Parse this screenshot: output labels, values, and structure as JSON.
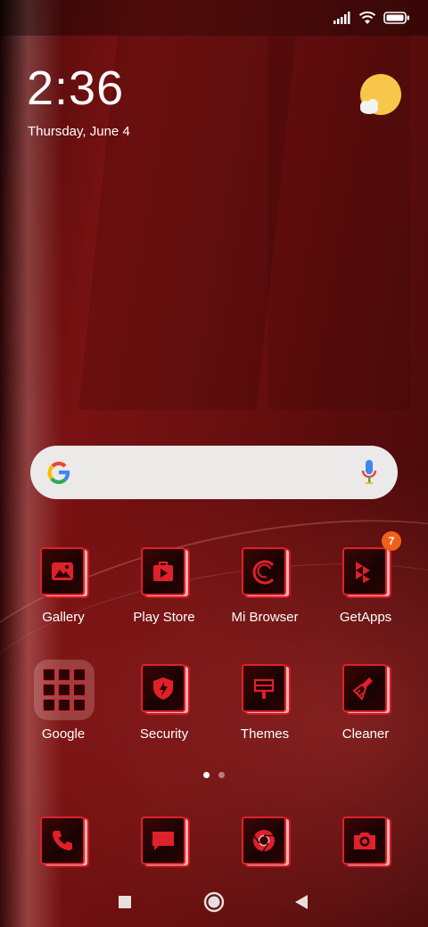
{
  "status": {
    "signal_icon": "signal-bars-icon",
    "wifi_icon": "wifi-icon",
    "battery_icon": "battery-icon"
  },
  "clock": {
    "time": "2:36",
    "date": "Thursday, June 4"
  },
  "weather": {
    "icon": "sunny-partly-cloudy-icon"
  },
  "search": {
    "logo_icon": "google-g-icon",
    "mic_icon": "microphone-icon"
  },
  "apps_row1": [
    {
      "label": "Gallery",
      "icon": "gallery-icon"
    },
    {
      "label": "Play Store",
      "icon": "play-store-icon"
    },
    {
      "label": "Mi Browser",
      "icon": "browser-icon"
    },
    {
      "label": "GetApps",
      "icon": "getapps-icon",
      "badge": "7"
    }
  ],
  "apps_row2": [
    {
      "label": "Google",
      "icon": "folder-icon"
    },
    {
      "label": "Security",
      "icon": "security-icon"
    },
    {
      "label": "Themes",
      "icon": "themes-icon"
    },
    {
      "label": "Cleaner",
      "icon": "cleaner-icon"
    }
  ],
  "page_indicator": {
    "pages": 2,
    "current": 1
  },
  "dock": [
    {
      "icon": "phone-icon"
    },
    {
      "icon": "messages-icon"
    },
    {
      "icon": "chrome-icon"
    },
    {
      "icon": "camera-icon"
    }
  ],
  "navbar": {
    "recents_icon": "recents-square-icon",
    "home_icon": "home-circle-icon",
    "back_icon": "back-triangle-icon"
  },
  "colors": {
    "accent": "#e0202a",
    "badge": "#f06018"
  }
}
